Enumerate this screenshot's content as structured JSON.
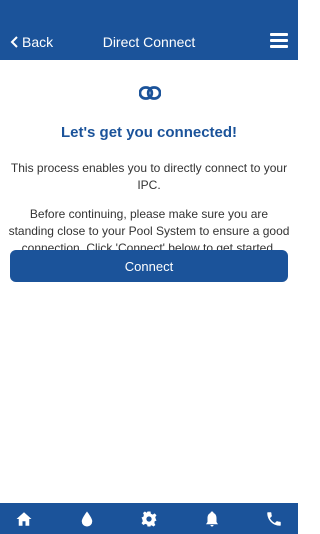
{
  "header": {
    "back_label": "Back",
    "title": "Direct Connect",
    "menu_icon": "hamburger-menu-icon"
  },
  "main": {
    "icon": "link-icon",
    "heading": "Let's get you connected!",
    "paragraph1": "This process enables you to directly connect to your IPC.",
    "paragraph2": "Before continuing, please make sure you are standing close to your Pool System to ensure a good connection. Click 'Connect' below to get started.",
    "connect_button": "Connect"
  },
  "tabbar": {
    "items": [
      "home-icon",
      "water-drop-icon",
      "gear-icon",
      "bell-icon",
      "phone-icon"
    ]
  },
  "colors": {
    "primary": "#1b539a",
    "text": "#333333",
    "background": "#ffffff"
  }
}
